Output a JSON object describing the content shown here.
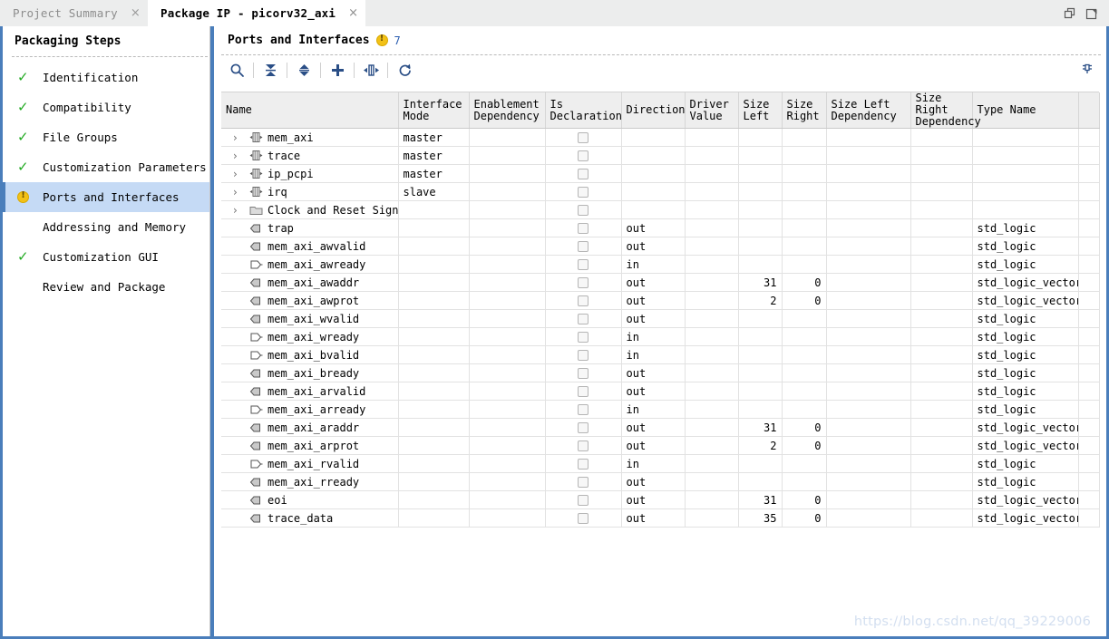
{
  "window": {
    "restore_icon": "restore-window-icon",
    "float_icon": "float-window-icon"
  },
  "tabs": [
    {
      "label": "Project Summary",
      "active": false,
      "close": "×"
    },
    {
      "label": "Package IP - picorv32_axi",
      "active": true,
      "close": "×"
    }
  ],
  "sidebar": {
    "title": "Packaging Steps",
    "items": [
      {
        "label": "Identification",
        "status": "check"
      },
      {
        "label": "Compatibility",
        "status": "check"
      },
      {
        "label": "File Groups",
        "status": "check"
      },
      {
        "label": "Customization Parameters",
        "status": "check"
      },
      {
        "label": "Ports and Interfaces",
        "status": "warning",
        "selected": true
      },
      {
        "label": "Addressing and Memory",
        "status": "none"
      },
      {
        "label": "Customization GUI",
        "status": "check"
      },
      {
        "label": "Review and Package",
        "status": "none"
      }
    ]
  },
  "panel": {
    "title": "Ports and Interfaces",
    "warning_count": "7",
    "toolbar": [
      {
        "name": "search-icon",
        "title": "Search"
      },
      {
        "name": "collapse-all-icon",
        "title": "Collapse All"
      },
      {
        "name": "expand-all-icon",
        "title": "Expand All"
      },
      {
        "name": "add-icon",
        "title": "Add"
      },
      {
        "name": "port-interface-icon",
        "title": "Auto Infer Interface"
      },
      {
        "name": "refresh-icon",
        "title": "Refresh"
      }
    ],
    "pin_icon": "pin-icon"
  },
  "table": {
    "columns": [
      "Name",
      "Interface\nMode",
      "Enablement\nDependency",
      "Is\nDeclaration",
      "Direction",
      "Driver\nValue",
      "Size\nLeft",
      "Size\nRight",
      "Size Left\nDependency",
      "Size Right\nDependency",
      "Type Name",
      ""
    ],
    "rows": [
      {
        "kind": "interface",
        "expander": "›",
        "icon": "bus-interface-icon",
        "name": "mem_axi",
        "mode": "master",
        "enablement": "",
        "is_decl": true,
        "direction": "",
        "driver": "",
        "size_left": "",
        "size_right": "",
        "sl_dep": "",
        "sr_dep": "",
        "type": ""
      },
      {
        "kind": "interface",
        "expander": "›",
        "icon": "bus-interface-icon",
        "name": "trace",
        "mode": "master",
        "enablement": "",
        "is_decl": true,
        "direction": "",
        "driver": "",
        "size_left": "",
        "size_right": "",
        "sl_dep": "",
        "sr_dep": "",
        "type": ""
      },
      {
        "kind": "interface",
        "expander": "›",
        "icon": "bus-interface-icon",
        "name": "ip_pcpi",
        "mode": "master",
        "enablement": "",
        "is_decl": true,
        "direction": "",
        "driver": "",
        "size_left": "",
        "size_right": "",
        "sl_dep": "",
        "sr_dep": "",
        "type": ""
      },
      {
        "kind": "interface",
        "expander": "›",
        "icon": "bus-interface-icon",
        "name": "irq",
        "mode": "slave",
        "enablement": "",
        "is_decl": true,
        "direction": "",
        "driver": "",
        "size_left": "",
        "size_right": "",
        "sl_dep": "",
        "sr_dep": "",
        "type": ""
      },
      {
        "kind": "folder",
        "expander": "›",
        "icon": "folder-icon",
        "name": "Clock and Reset Signals",
        "mode": "",
        "enablement": "",
        "is_decl": true,
        "direction": "",
        "driver": "",
        "size_left": "",
        "size_right": "",
        "sl_dep": "",
        "sr_dep": "",
        "type": ""
      },
      {
        "kind": "port",
        "expander": "",
        "icon": "output-port-icon",
        "name": "trap",
        "mode": "",
        "enablement": "",
        "is_decl": true,
        "direction": "out",
        "driver": "",
        "size_left": "",
        "size_right": "",
        "sl_dep": "",
        "sr_dep": "",
        "type": "std_logic"
      },
      {
        "kind": "port",
        "expander": "",
        "icon": "output-port-icon",
        "name": "mem_axi_awvalid",
        "mode": "",
        "enablement": "",
        "is_decl": true,
        "direction": "out",
        "driver": "",
        "size_left": "",
        "size_right": "",
        "sl_dep": "",
        "sr_dep": "",
        "type": "std_logic"
      },
      {
        "kind": "port",
        "expander": "",
        "icon": "input-port-icon",
        "name": "mem_axi_awready",
        "mode": "",
        "enablement": "",
        "is_decl": true,
        "direction": "in",
        "driver": "",
        "size_left": "",
        "size_right": "",
        "sl_dep": "",
        "sr_dep": "",
        "type": "std_logic"
      },
      {
        "kind": "port",
        "expander": "",
        "icon": "output-port-icon",
        "name": "mem_axi_awaddr",
        "mode": "",
        "enablement": "",
        "is_decl": true,
        "direction": "out",
        "driver": "",
        "size_left": "31",
        "size_right": "0",
        "sl_dep": "",
        "sr_dep": "",
        "type": "std_logic_vector"
      },
      {
        "kind": "port",
        "expander": "",
        "icon": "output-port-icon",
        "name": "mem_axi_awprot",
        "mode": "",
        "enablement": "",
        "is_decl": true,
        "direction": "out",
        "driver": "",
        "size_left": "2",
        "size_right": "0",
        "sl_dep": "",
        "sr_dep": "",
        "type": "std_logic_vector"
      },
      {
        "kind": "port",
        "expander": "",
        "icon": "output-port-icon",
        "name": "mem_axi_wvalid",
        "mode": "",
        "enablement": "",
        "is_decl": true,
        "direction": "out",
        "driver": "",
        "size_left": "",
        "size_right": "",
        "sl_dep": "",
        "sr_dep": "",
        "type": "std_logic"
      },
      {
        "kind": "port",
        "expander": "",
        "icon": "input-port-icon",
        "name": "mem_axi_wready",
        "mode": "",
        "enablement": "",
        "is_decl": true,
        "direction": "in",
        "driver": "",
        "size_left": "",
        "size_right": "",
        "sl_dep": "",
        "sr_dep": "",
        "type": "std_logic"
      },
      {
        "kind": "port",
        "expander": "",
        "icon": "input-port-icon",
        "name": "mem_axi_bvalid",
        "mode": "",
        "enablement": "",
        "is_decl": true,
        "direction": "in",
        "driver": "",
        "size_left": "",
        "size_right": "",
        "sl_dep": "",
        "sr_dep": "",
        "type": "std_logic"
      },
      {
        "kind": "port",
        "expander": "",
        "icon": "output-port-icon",
        "name": "mem_axi_bready",
        "mode": "",
        "enablement": "",
        "is_decl": true,
        "direction": "out",
        "driver": "",
        "size_left": "",
        "size_right": "",
        "sl_dep": "",
        "sr_dep": "",
        "type": "std_logic"
      },
      {
        "kind": "port",
        "expander": "",
        "icon": "output-port-icon",
        "name": "mem_axi_arvalid",
        "mode": "",
        "enablement": "",
        "is_decl": true,
        "direction": "out",
        "driver": "",
        "size_left": "",
        "size_right": "",
        "sl_dep": "",
        "sr_dep": "",
        "type": "std_logic"
      },
      {
        "kind": "port",
        "expander": "",
        "icon": "input-port-icon",
        "name": "mem_axi_arready",
        "mode": "",
        "enablement": "",
        "is_decl": true,
        "direction": "in",
        "driver": "",
        "size_left": "",
        "size_right": "",
        "sl_dep": "",
        "sr_dep": "",
        "type": "std_logic"
      },
      {
        "kind": "port",
        "expander": "",
        "icon": "output-port-icon",
        "name": "mem_axi_araddr",
        "mode": "",
        "enablement": "",
        "is_decl": true,
        "direction": "out",
        "driver": "",
        "size_left": "31",
        "size_right": "0",
        "sl_dep": "",
        "sr_dep": "",
        "type": "std_logic_vector"
      },
      {
        "kind": "port",
        "expander": "",
        "icon": "output-port-icon",
        "name": "mem_axi_arprot",
        "mode": "",
        "enablement": "",
        "is_decl": true,
        "direction": "out",
        "driver": "",
        "size_left": "2",
        "size_right": "0",
        "sl_dep": "",
        "sr_dep": "",
        "type": "std_logic_vector"
      },
      {
        "kind": "port",
        "expander": "",
        "icon": "input-port-icon",
        "name": "mem_axi_rvalid",
        "mode": "",
        "enablement": "",
        "is_decl": true,
        "direction": "in",
        "driver": "",
        "size_left": "",
        "size_right": "",
        "sl_dep": "",
        "sr_dep": "",
        "type": "std_logic"
      },
      {
        "kind": "port",
        "expander": "",
        "icon": "output-port-icon",
        "name": "mem_axi_rready",
        "mode": "",
        "enablement": "",
        "is_decl": true,
        "direction": "out",
        "driver": "",
        "size_left": "",
        "size_right": "",
        "sl_dep": "",
        "sr_dep": "",
        "type": "std_logic"
      },
      {
        "kind": "port",
        "expander": "",
        "icon": "output-port-icon",
        "name": "eoi",
        "mode": "",
        "enablement": "",
        "is_decl": true,
        "direction": "out",
        "driver": "",
        "size_left": "31",
        "size_right": "0",
        "sl_dep": "",
        "sr_dep": "",
        "type": "std_logic_vector"
      },
      {
        "kind": "port",
        "expander": "",
        "icon": "output-port-icon",
        "name": "trace_data",
        "mode": "",
        "enablement": "",
        "is_decl": true,
        "direction": "out",
        "driver": "",
        "size_left": "35",
        "size_right": "0",
        "sl_dep": "",
        "sr_dep": "",
        "type": "std_logic_vector"
      }
    ]
  },
  "watermark": "https://blog.csdn.net/qq_39229006",
  "colors": {
    "titlebar": "#4a7ebb",
    "selection": "#c5daf5",
    "icon_blue": "#2a4e86",
    "check_green": "#22aa22",
    "warning_yellow": "#f2c117"
  }
}
